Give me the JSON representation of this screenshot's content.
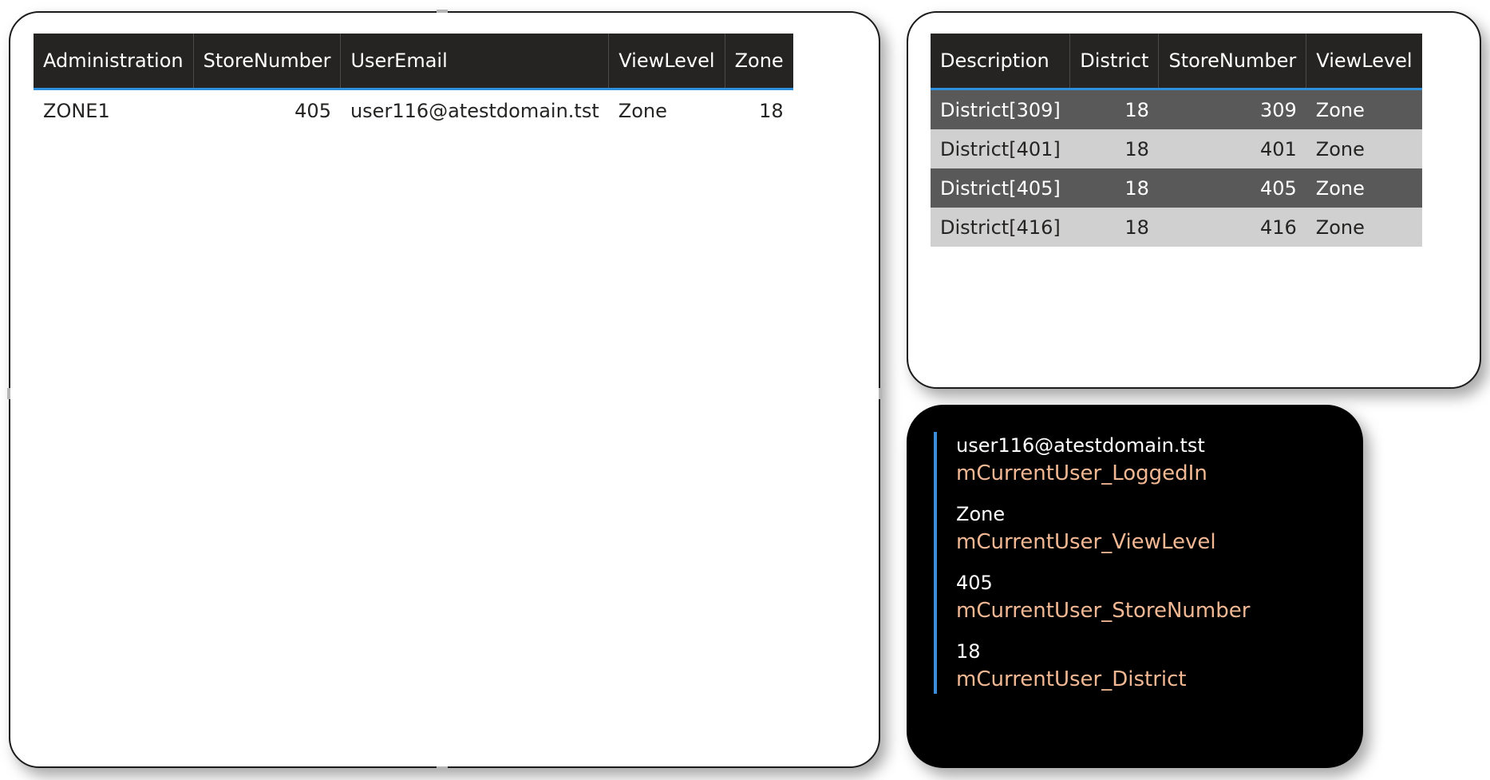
{
  "left_table": {
    "columns": [
      "Administration",
      "StoreNumber",
      "UserEmail",
      "ViewLevel",
      "Zone"
    ],
    "rows": [
      [
        "ZONE1",
        "405",
        "user116@atestdomain.tst",
        "Zone",
        "18"
      ]
    ]
  },
  "right_table": {
    "columns": [
      "Description",
      "District",
      "StoreNumber",
      "ViewLevel"
    ],
    "rows": [
      [
        "District[309]",
        "18",
        "309",
        "Zone"
      ],
      [
        "District[401]",
        "18",
        "401",
        "Zone"
      ],
      [
        "District[405]",
        "18",
        "405",
        "Zone"
      ],
      [
        "District[416]",
        "18",
        "416",
        "Zone"
      ]
    ]
  },
  "multi_card": {
    "items": [
      {
        "value": "user116@atestdomain.tst",
        "label": "mCurrentUser_LoggedIn"
      },
      {
        "value": "Zone",
        "label": "mCurrentUser_ViewLevel"
      },
      {
        "value": "405",
        "label": "mCurrentUser_StoreNumber"
      },
      {
        "value": "18",
        "label": "mCurrentUser_District"
      }
    ]
  },
  "colors": {
    "header_bg": "#252423",
    "header_accent": "#2e8fdd",
    "row_dark": "#595959",
    "row_light": "#d0d0d0",
    "card_label": "#f2b894"
  }
}
